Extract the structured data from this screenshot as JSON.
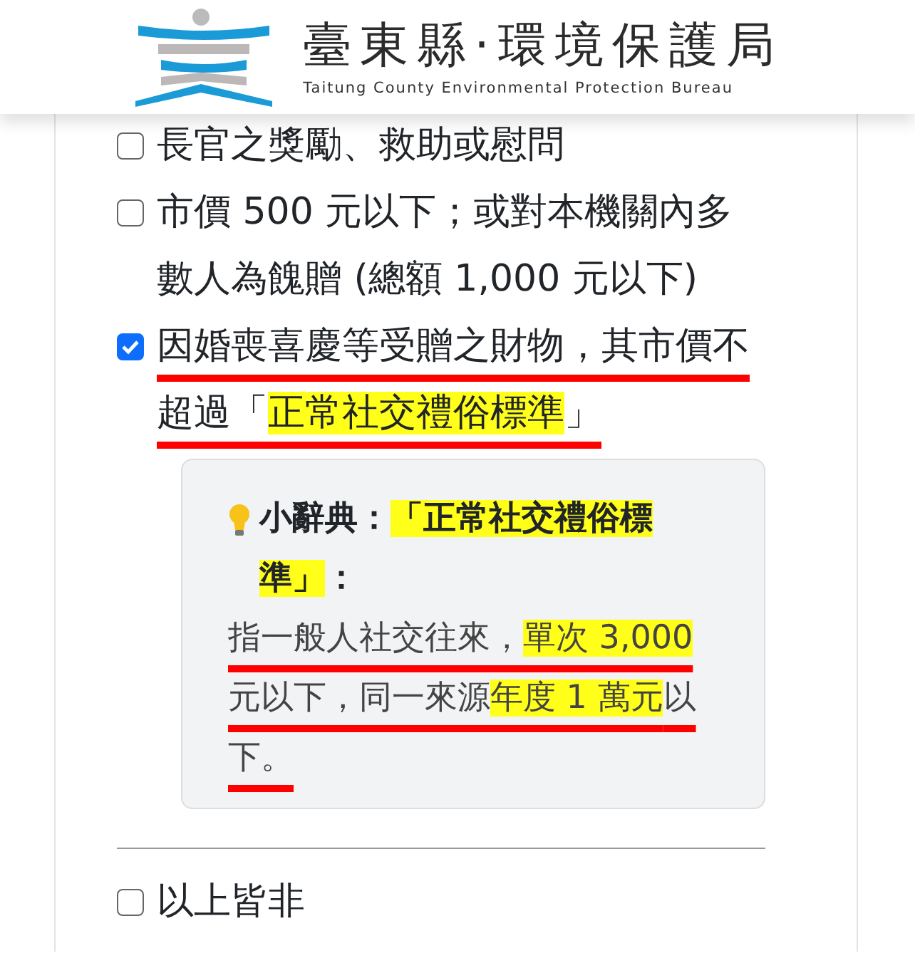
{
  "header": {
    "title": "臺東縣·環境保護局",
    "subtitle": "Taitung County Environmental Protection Bureau"
  },
  "options": [
    {
      "segments": [
        {
          "text": "長官之獎勵、救助或慰問",
          "highlighted": false
        }
      ],
      "checked": false,
      "underlined": false
    },
    {
      "segments": [
        {
          "text": "市價 500 元以下；或對本機關內多數人為餽贈 (總額 1,000 元以下)",
          "highlighted": false
        }
      ],
      "checked": false,
      "underlined": false
    },
    {
      "segments": [
        {
          "text": "因婚喪喜慶等受贈之財物，其市價不超過「",
          "highlighted": false
        },
        {
          "text": "正常社交禮俗標準",
          "highlighted": true
        },
        {
          "text": "」",
          "highlighted": false
        }
      ],
      "checked": true,
      "underlined": true
    }
  ],
  "dictionary": {
    "title_segments": [
      {
        "text": "小辭典：",
        "highlighted": false
      },
      {
        "text": "「正常社交禮俗標準」",
        "highlighted": true
      },
      {
        "text": "：",
        "highlighted": false
      }
    ],
    "body_segments": [
      {
        "text": "指一般人社交往來，",
        "highlighted": false
      },
      {
        "text": "單次 3,000",
        "highlighted": true
      },
      {
        "text": " 元以下，同一來源",
        "highlighted": false
      },
      {
        "text": "年度 1 萬元",
        "highlighted": true
      },
      {
        "text": "以下。",
        "highlighted": false
      }
    ],
    "underlined": true
  },
  "last_option": {
    "label": "以上皆非",
    "checked": false
  }
}
